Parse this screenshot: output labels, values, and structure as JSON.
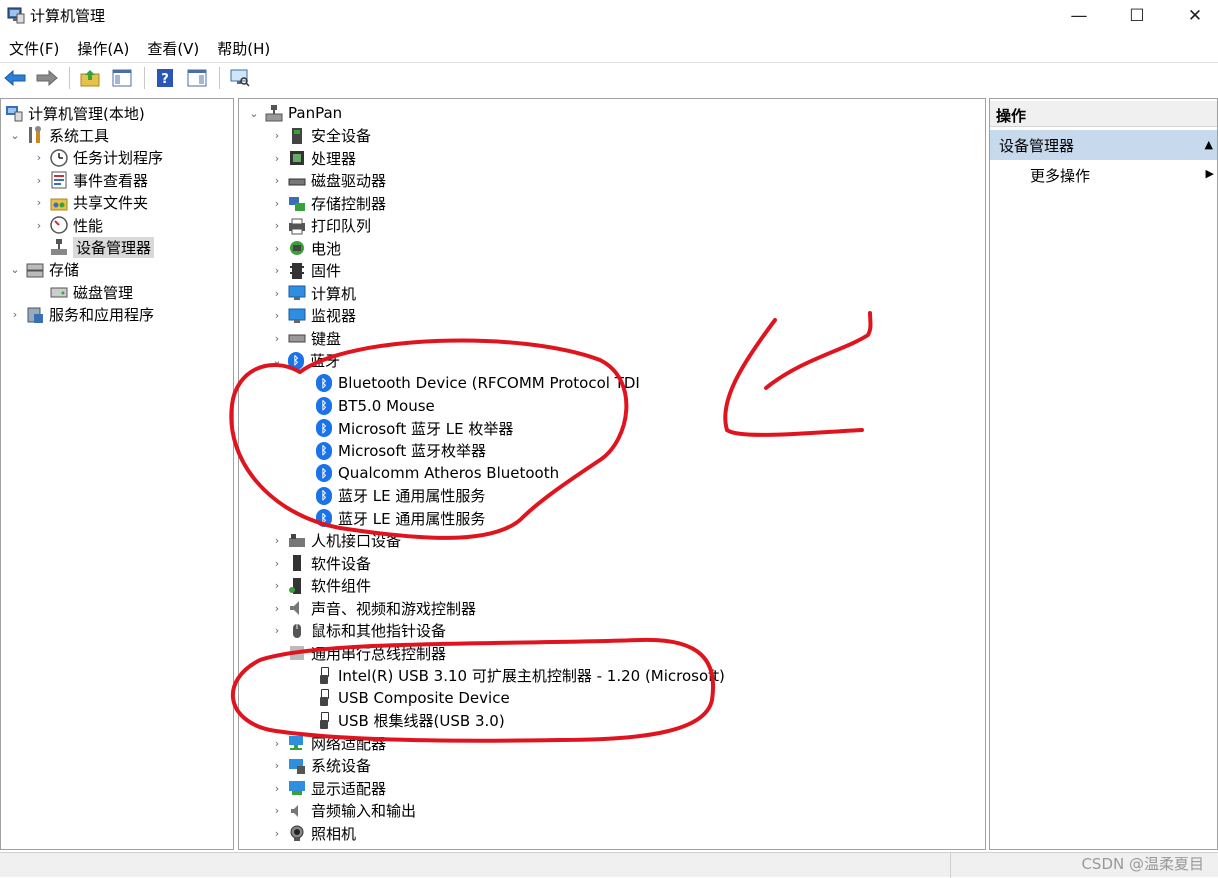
{
  "window": {
    "title": "计算机管理",
    "min_glyph": "—",
    "max_glyph": "☐",
    "close_glyph": "✕"
  },
  "menu": [
    {
      "label": "文件(F)"
    },
    {
      "label": "操作(A)"
    },
    {
      "label": "查看(V)"
    },
    {
      "label": "帮助(H)"
    }
  ],
  "left_tree": [
    {
      "label": "计算机管理(本地)",
      "expander": "",
      "icon": "computer-management-icon",
      "level": 0
    },
    {
      "label": "系统工具",
      "expander": "⌄",
      "icon": "tools-icon",
      "level": 1
    },
    {
      "label": "任务计划程序",
      "expander": "›",
      "icon": "clock-icon",
      "level": 2
    },
    {
      "label": "事件查看器",
      "expander": "›",
      "icon": "event-viewer-icon",
      "level": 2
    },
    {
      "label": "共享文件夹",
      "expander": "›",
      "icon": "shared-folder-icon",
      "level": 2
    },
    {
      "label": "性能",
      "expander": "›",
      "icon": "performance-icon",
      "level": 2
    },
    {
      "label": "设备管理器",
      "expander": "",
      "icon": "device-manager-icon",
      "level": 2,
      "selected": true
    },
    {
      "label": "存储",
      "expander": "⌄",
      "icon": "storage-icon",
      "level": 1
    },
    {
      "label": "磁盘管理",
      "expander": "",
      "icon": "disk-management-icon",
      "level": 2
    },
    {
      "label": "服务和应用程序",
      "expander": "›",
      "icon": "services-icon",
      "level": 1
    }
  ],
  "device_tree": {
    "root": {
      "label": "PanPan",
      "expander": "⌄"
    },
    "categories": [
      {
        "label": "安全设备",
        "icon": "security-device-icon"
      },
      {
        "label": "处理器",
        "icon": "processor-icon"
      },
      {
        "label": "磁盘驱动器",
        "icon": "disk-drive-icon"
      },
      {
        "label": "存储控制器",
        "icon": "storage-controller-icon"
      },
      {
        "label": "打印队列",
        "icon": "printer-icon"
      },
      {
        "label": "电池",
        "icon": "battery-icon"
      },
      {
        "label": "固件",
        "icon": "firmware-icon"
      },
      {
        "label": "计算机",
        "icon": "computer-icon"
      },
      {
        "label": "监视器",
        "icon": "monitor-icon"
      },
      {
        "label": "键盘",
        "icon": "keyboard-icon"
      },
      {
        "label": "蓝牙",
        "icon": "bluetooth-icon",
        "expanded": true
      },
      {
        "label": "人机接口设备",
        "icon": "hid-icon"
      },
      {
        "label": "软件设备",
        "icon": "software-device-icon"
      },
      {
        "label": "软件组件",
        "icon": "software-component-icon"
      },
      {
        "label": "声音、视频和游戏控制器",
        "icon": "sound-icon"
      },
      {
        "label": "鼠标和其他指针设备",
        "icon": "mouse-icon"
      },
      {
        "label": "通用串行总线控制器",
        "icon": "usb-icon",
        "expanded": true
      },
      {
        "label": "网络适配器",
        "icon": "network-adapter-icon"
      },
      {
        "label": "系统设备",
        "icon": "system-device-icon"
      },
      {
        "label": "显示适配器",
        "icon": "display-adapter-icon"
      },
      {
        "label": "音频输入和输出",
        "icon": "audio-io-icon"
      },
      {
        "label": "照相机",
        "icon": "camera-icon"
      }
    ],
    "bluetooth_devices": [
      "Bluetooth Device (RFCOMM Protocol TDI",
      "BT5.0 Mouse",
      "Microsoft 蓝牙 LE 枚举器",
      "Microsoft 蓝牙枚举器",
      "Qualcomm Atheros Bluetooth",
      "蓝牙 LE 通用属性服务",
      "蓝牙 LE 通用属性服务"
    ],
    "usb_devices": [
      "Intel(R) USB 3.10 可扩展主机控制器 - 1.20 (Microsoft)",
      "USB Composite Device",
      "USB 根集线器(USB 3.0)"
    ],
    "collapsed_glyph": "›",
    "expanded_glyph": "⌄",
    "bluetooth_glyph": "ᛒ"
  },
  "actions": {
    "header": "操作",
    "section": "设备管理器",
    "section_arrow": "▲",
    "item": "更多操作",
    "item_arrow": "▶"
  },
  "watermark": "CSDN @温柔夏目",
  "colors": {
    "annotation_red": "#e0141e",
    "selection_bg": "#d9d9d9",
    "actions_section_bg": "#c7d9ec"
  }
}
